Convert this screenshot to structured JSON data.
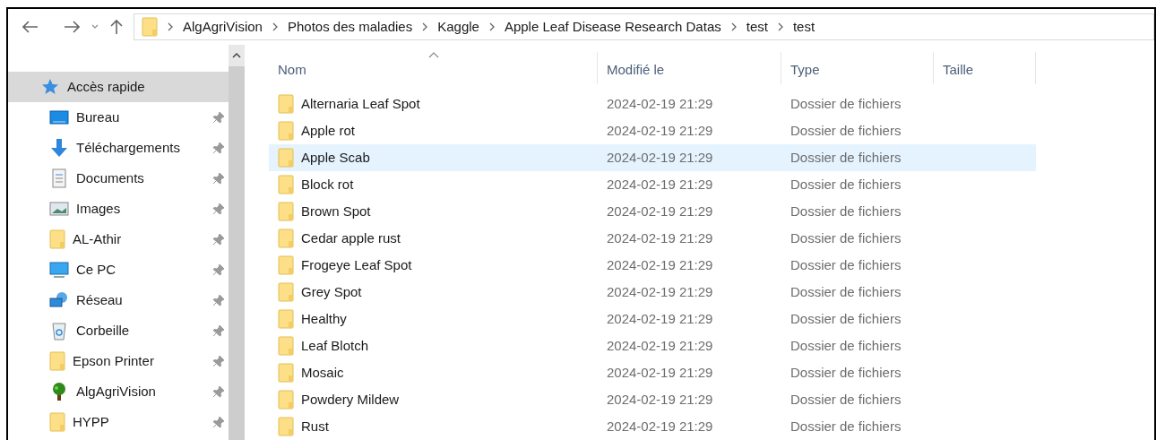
{
  "breadcrumb": [
    "AlgAgriVision",
    "Photos des maladies",
    "Kaggle",
    "Apple Leaf Disease Research Datas",
    "test",
    "test"
  ],
  "sidebar": {
    "items": [
      {
        "label": "Accès rapide",
        "kind": "star",
        "selected": true,
        "pinned": false
      },
      {
        "label": "Bureau",
        "kind": "desktop",
        "selected": false,
        "pinned": true
      },
      {
        "label": "Téléchargements",
        "kind": "download",
        "selected": false,
        "pinned": true
      },
      {
        "label": "Documents",
        "kind": "document",
        "selected": false,
        "pinned": true
      },
      {
        "label": "Images",
        "kind": "image",
        "selected": false,
        "pinned": true
      },
      {
        "label": "AL-Athir",
        "kind": "folder",
        "selected": false,
        "pinned": true
      },
      {
        "label": "Ce PC",
        "kind": "pc",
        "selected": false,
        "pinned": true
      },
      {
        "label": "Réseau",
        "kind": "network",
        "selected": false,
        "pinned": true
      },
      {
        "label": "Corbeille",
        "kind": "recycle",
        "selected": false,
        "pinned": true
      },
      {
        "label": "Epson Printer",
        "kind": "folder",
        "selected": false,
        "pinned": true
      },
      {
        "label": "AlgAgriVision",
        "kind": "tree",
        "selected": false,
        "pinned": true
      },
      {
        "label": "HYPP",
        "kind": "folder",
        "selected": false,
        "pinned": true
      }
    ]
  },
  "table": {
    "columns": [
      "Nom",
      "Modifié le",
      "Type",
      "Taille"
    ],
    "rows": [
      {
        "name": "Alternaria Leaf Spot",
        "modified": "2024-02-19 21:29",
        "type": "Dossier de fichiers",
        "selected": false
      },
      {
        "name": "Apple rot",
        "modified": "2024-02-19 21:29",
        "type": "Dossier de fichiers",
        "selected": false
      },
      {
        "name": "Apple Scab",
        "modified": "2024-02-19 21:29",
        "type": "Dossier de fichiers",
        "selected": true
      },
      {
        "name": "Block rot",
        "modified": "2024-02-19 21:29",
        "type": "Dossier de fichiers",
        "selected": false
      },
      {
        "name": "Brown Spot",
        "modified": "2024-02-19 21:29",
        "type": "Dossier de fichiers",
        "selected": false
      },
      {
        "name": "Cedar apple rust",
        "modified": "2024-02-19 21:29",
        "type": "Dossier de fichiers",
        "selected": false
      },
      {
        "name": "Frogeye Leaf Spot",
        "modified": "2024-02-19 21:29",
        "type": "Dossier de fichiers",
        "selected": false
      },
      {
        "name": "Grey Spot",
        "modified": "2024-02-19 21:29",
        "type": "Dossier de fichiers",
        "selected": false
      },
      {
        "name": "Healthy",
        "modified": "2024-02-19 21:29",
        "type": "Dossier de fichiers",
        "selected": false
      },
      {
        "name": "Leaf Blotch",
        "modified": "2024-02-19 21:29",
        "type": "Dossier de fichiers",
        "selected": false
      },
      {
        "name": "Mosaic",
        "modified": "2024-02-19 21:29",
        "type": "Dossier de fichiers",
        "selected": false
      },
      {
        "name": "Powdery Mildew",
        "modified": "2024-02-19 21:29",
        "type": "Dossier de fichiers",
        "selected": false
      },
      {
        "name": "Rust",
        "modified": "2024-02-19 21:29",
        "type": "Dossier de fichiers",
        "selected": false
      }
    ]
  }
}
